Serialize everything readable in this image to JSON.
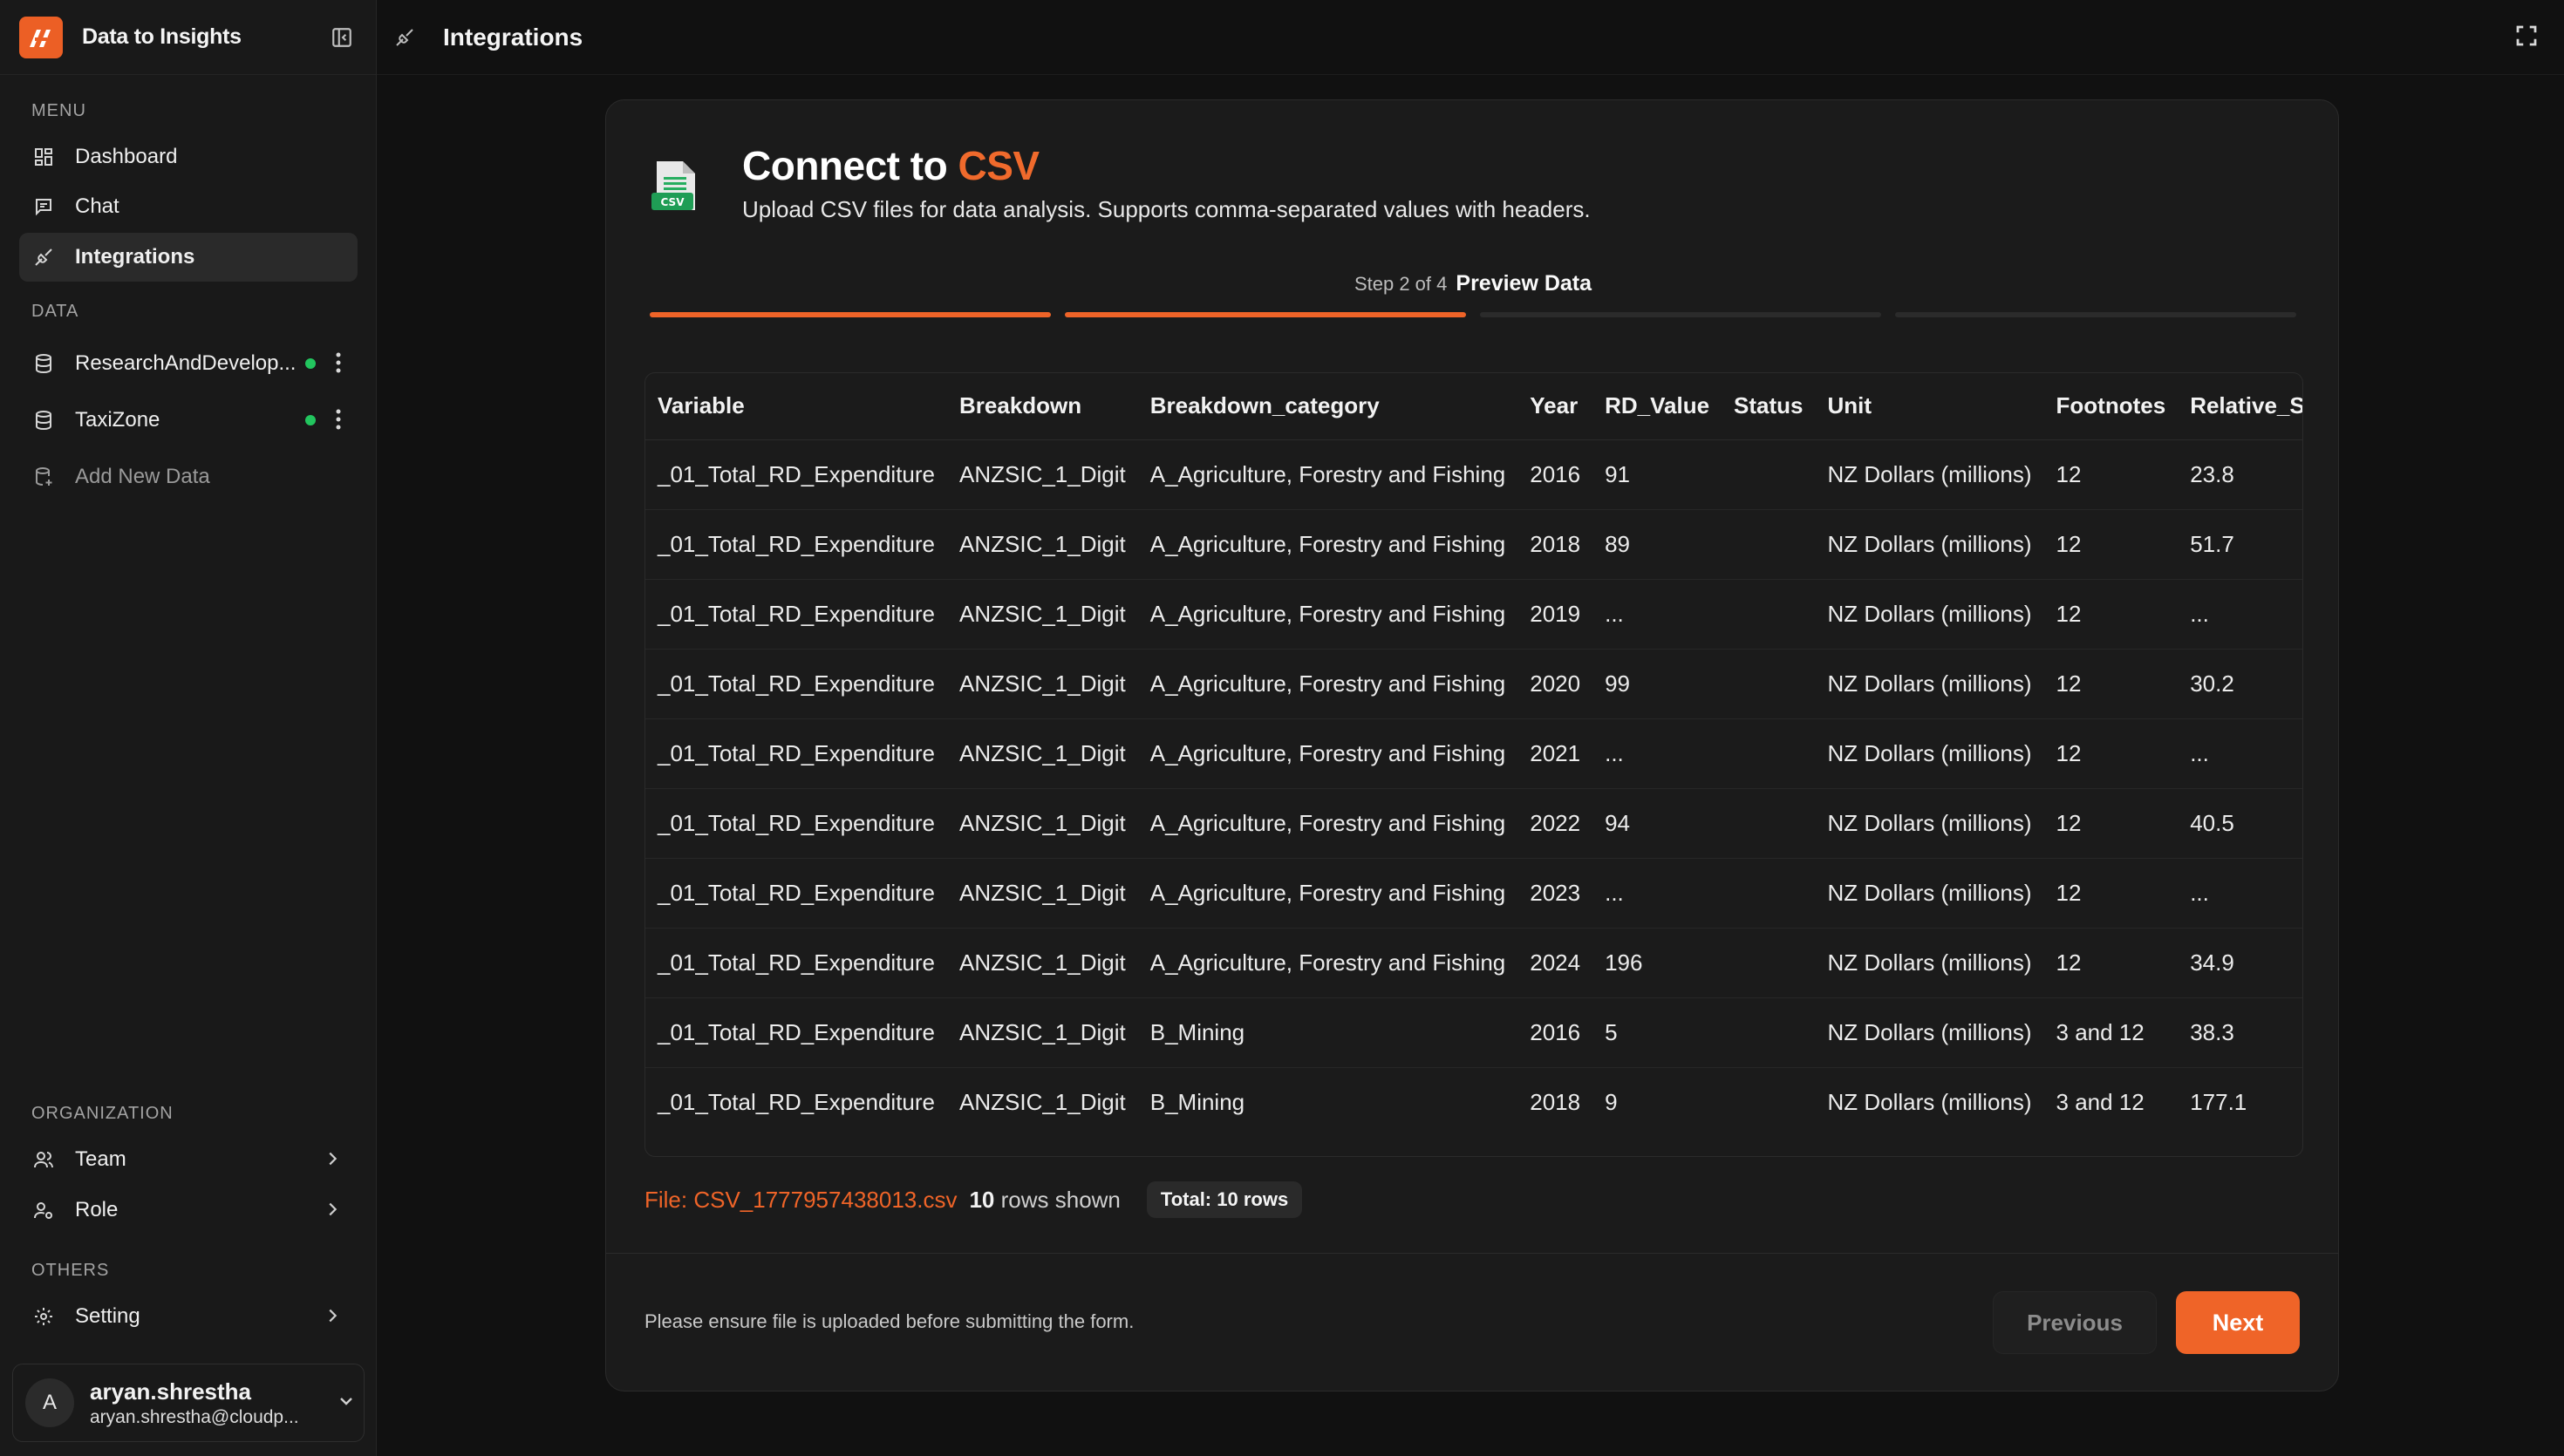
{
  "app": {
    "name": "Data to Insights"
  },
  "sidebar": {
    "menu_label": "MENU",
    "menu": [
      {
        "label": "Dashboard",
        "icon": "grid-icon"
      },
      {
        "label": "Chat",
        "icon": "chat-icon"
      },
      {
        "label": "Integrations",
        "icon": "plug-icon",
        "active": true
      }
    ],
    "data_label": "DATA",
    "datasets": [
      {
        "label": "ResearchAndDevelop...",
        "status": "connected"
      },
      {
        "label": "TaxiZone",
        "status": "connected"
      }
    ],
    "add_data_label": "Add New Data",
    "org_label": "ORGANIZATION",
    "org": [
      {
        "label": "Team"
      },
      {
        "label": "Role"
      }
    ],
    "others_label": "OTHERS",
    "others": [
      {
        "label": "Setting"
      }
    ],
    "user": {
      "initial": "A",
      "name": "aryan.shrestha",
      "email": "aryan.shrestha@cloudp..."
    }
  },
  "topbar": {
    "title": "Integrations"
  },
  "card": {
    "title_prefix": "Connect to ",
    "title_accent": "CSV",
    "subtitle": "Upload CSV files for data analysis. Supports comma-separated values with headers.",
    "step": {
      "text": "Step 2 of 4",
      "name": "Preview Data",
      "current": 2,
      "total": 4
    },
    "table": {
      "columns": [
        "Variable",
        "Breakdown",
        "Breakdown_category",
        "Year",
        "RD_Value",
        "Status",
        "Unit",
        "Footnotes",
        "Relative_Sampling_Error"
      ],
      "rows": [
        [
          "_01_Total_RD_Expenditure",
          "ANZSIC_1_Digit",
          "A_Agriculture, Forestry and Fishing",
          "2016",
          "91",
          "",
          "NZ Dollars (millions)",
          "12",
          "23.8"
        ],
        [
          "_01_Total_RD_Expenditure",
          "ANZSIC_1_Digit",
          "A_Agriculture, Forestry and Fishing",
          "2018",
          "89",
          "",
          "NZ Dollars (millions)",
          "12",
          "51.7"
        ],
        [
          "_01_Total_RD_Expenditure",
          "ANZSIC_1_Digit",
          "A_Agriculture, Forestry and Fishing",
          "2019",
          "...",
          "",
          "NZ Dollars (millions)",
          "12",
          "..."
        ],
        [
          "_01_Total_RD_Expenditure",
          "ANZSIC_1_Digit",
          "A_Agriculture, Forestry and Fishing",
          "2020",
          "99",
          "",
          "NZ Dollars (millions)",
          "12",
          "30.2"
        ],
        [
          "_01_Total_RD_Expenditure",
          "ANZSIC_1_Digit",
          "A_Agriculture, Forestry and Fishing",
          "2021",
          "...",
          "",
          "NZ Dollars (millions)",
          "12",
          "..."
        ],
        [
          "_01_Total_RD_Expenditure",
          "ANZSIC_1_Digit",
          "A_Agriculture, Forestry and Fishing",
          "2022",
          "94",
          "",
          "NZ Dollars (millions)",
          "12",
          "40.5"
        ],
        [
          "_01_Total_RD_Expenditure",
          "ANZSIC_1_Digit",
          "A_Agriculture, Forestry and Fishing",
          "2023",
          "...",
          "",
          "NZ Dollars (millions)",
          "12",
          "..."
        ],
        [
          "_01_Total_RD_Expenditure",
          "ANZSIC_1_Digit",
          "A_Agriculture, Forestry and Fishing",
          "2024",
          "196",
          "",
          "NZ Dollars (millions)",
          "12",
          "34.9"
        ],
        [
          "_01_Total_RD_Expenditure",
          "ANZSIC_1_Digit",
          "B_Mining",
          "2016",
          "5",
          "",
          "NZ Dollars (millions)",
          "3 and 12",
          "38.3"
        ],
        [
          "_01_Total_RD_Expenditure",
          "ANZSIC_1_Digit",
          "B_Mining",
          "2018",
          "9",
          "",
          "NZ Dollars (millions)",
          "3 and 12",
          "177.1"
        ]
      ]
    },
    "file": {
      "label": "File: CSV_1777957438013.csv",
      "rows_count": "10",
      "rows_suffix": " rows shown",
      "total": "Total: 10 rows"
    },
    "footer_note": "Please ensure file is uploaded before submitting the form.",
    "prev_label": "Previous",
    "next_label": "Next"
  },
  "colors": {
    "accent": "#ef6428",
    "status_connected": "#22c55e",
    "background": "#111111"
  }
}
